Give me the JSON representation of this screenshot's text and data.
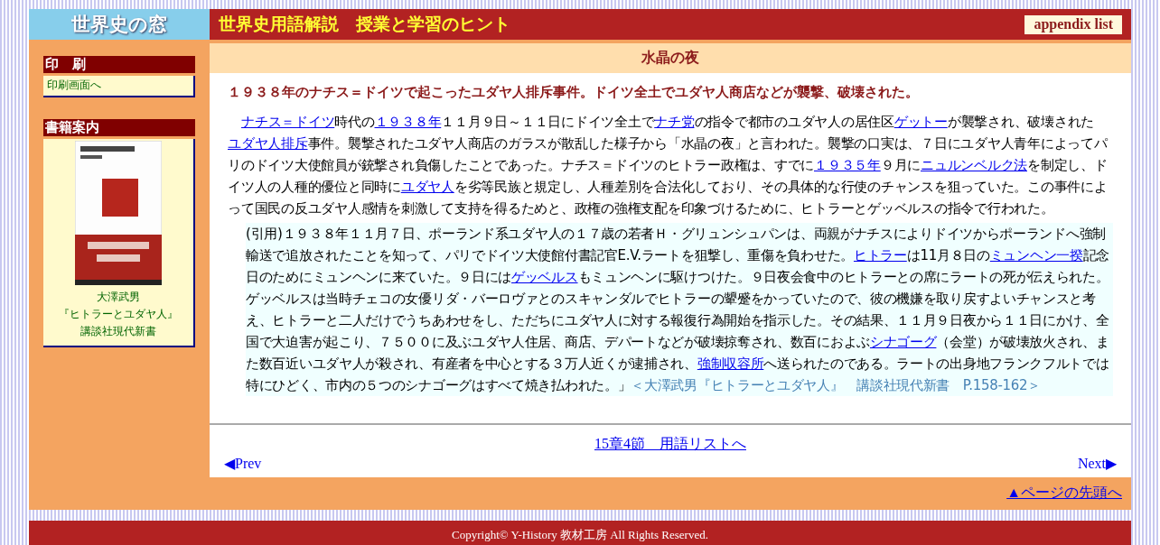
{
  "header": {
    "logo": "世界史の窓",
    "title": "世界史用語解説　授業と学習のヒント",
    "appendix_button": "appendix list"
  },
  "sidebar": {
    "sections": [
      {
        "heading": "印　刷",
        "kind": "links",
        "links": [
          "印刷画面へ"
        ]
      },
      {
        "heading": "書籍案内",
        "kind": "book",
        "lines": [
          "大澤武男",
          "『ヒトラーとユダヤ人』",
          "講談社現代新書"
        ]
      }
    ]
  },
  "article": {
    "title": "水晶の夜",
    "lead": "１９３８年のナチス＝ドイツで起こったユダヤ人排斥事件。ドイツ全土でユダヤ人商店などが襲撃、破壊された。",
    "paragraph": [
      {
        "kind": "link",
        "text": "ナチス＝ドイツ"
      },
      {
        "kind": "text",
        "text": "時代の"
      },
      {
        "kind": "link",
        "text": "１９３８年"
      },
      {
        "kind": "text",
        "text": "１１月９日～１１日にドイツ全土で"
      },
      {
        "kind": "link",
        "text": "ナチ党"
      },
      {
        "kind": "text",
        "text": "の指令で都市のユダヤ人の居住区"
      },
      {
        "kind": "link",
        "text": "ゲットー"
      },
      {
        "kind": "text",
        "text": "が襲撃され、破壊された"
      },
      {
        "kind": "link",
        "text": "ユダヤ人排斥"
      },
      {
        "kind": "text",
        "text": "事件。襲撃されたユダヤ人商店のガラスが散乱した様子から「水晶の夜」と言われた。襲撃の口実は、７日にユダヤ人青年によってパリのドイツ大使館員が銃撃され負傷したことであった。ナチス＝ドイツのヒトラー政権は、すでに"
      },
      {
        "kind": "link",
        "text": "１９３５年"
      },
      {
        "kind": "text",
        "text": "９月に"
      },
      {
        "kind": "link",
        "text": "ニュルンベルク法"
      },
      {
        "kind": "text",
        "text": "を制定し、ドイツ人の人種的優位と同時に"
      },
      {
        "kind": "link",
        "text": "ユダヤ人"
      },
      {
        "kind": "text",
        "text": "を劣等民族と規定し、人種差別を合法化しており、その具体的な行使のチャンスを狙っていた。この事件によって国民の反ユダヤ人感情を刺激して支持を得るためと、政権の強権支配を印象づけるために、ヒトラーとゲッベルスの指令で行われた。"
      }
    ],
    "quote": [
      {
        "kind": "text",
        "text": "(引用)１９３８年１１月７日、ポーランド系ユダヤ人の１７歳の若者Ｈ・グリュンシュパンは、両親がナチスによりドイツからポーランドへ強制輸送で追放されたことを知って、パリでドイツ大使館付書記官E.V.ラートを狙撃し、重傷を負わせた。"
      },
      {
        "kind": "link",
        "text": "ヒトラー"
      },
      {
        "kind": "text",
        "text": "は11月８日の"
      },
      {
        "kind": "link",
        "text": "ミュンヘン一揆"
      },
      {
        "kind": "text",
        "text": "記念日のためにミュンヘンに来ていた。９日には"
      },
      {
        "kind": "link",
        "text": "ゲッベルス"
      },
      {
        "kind": "text",
        "text": "もミュンヘンに駆けつけた。９日夜会食中のヒトラーとの席にラートの死が伝えられた。ゲッベルスは当時チェコの女優リダ・バーロヴァとのスキャンダルでヒトラーの顰蹙をかっていたので、彼の機嫌を取り戻すよいチャンスと考え、ヒトラーと二人だけでうちあわせをし、ただちにユダヤ人に対する報復行為開始を指示した。その結果、１１月９日夜から１１日にかけ、全国で大迫害が起こり、７５００に及ぶユダヤ人住居、商店、デパートなどが破壊掠奪され、数百におよぶ"
      },
      {
        "kind": "link",
        "text": "シナゴーグ"
      },
      {
        "kind": "text",
        "text": "（会堂）が破壊放火され、また数百近いユダヤ人が殺され、有産者を中心とする３万人近くが逮捕され、"
      },
      {
        "kind": "link",
        "text": "強制収容所"
      },
      {
        "kind": "text",
        "text": "へ送られたのである。ラートの出身地フランクフルトでは特にひどく、市内の５つのシナゴーグはすべて焼き払われた。」"
      },
      {
        "kind": "source",
        "text": "＜大澤武男『ヒトラーとユダヤ人』　講談社現代新書　P.158-162＞"
      }
    ]
  },
  "nav": {
    "list_link": "15章4節　用語リストへ",
    "prev": "◀Prev",
    "next": "Next▶"
  },
  "page_top": "▲ページの先頭へ",
  "footer": "Copyright© Y-History 教材工房 All Rights Reserved."
}
